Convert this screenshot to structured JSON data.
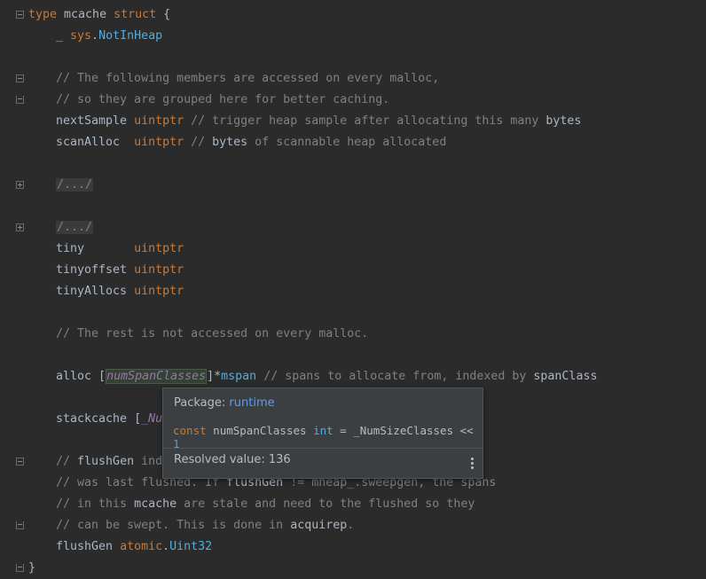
{
  "editor": {
    "lines": {
      "l1_kw": "type",
      "l1_name": " mcache ",
      "l1_kw2": "struct",
      "l1_brace": " {",
      "l2_us": "_ ",
      "l2_pkg": "sys",
      "l2_dot": ".",
      "l2_type": "NotInHeap",
      "l4": "// The following members are accessed on every malloc,",
      "l5": "// so they are grouped here for better caching.",
      "l6_field": "nextSample ",
      "l6_type": "uintptr",
      "l6_cmt_a": " // trigger heap sample after allocating this many ",
      "l6_cmt_b": "bytes",
      "l7_field": "scanAlloc  ",
      "l7_type": "uintptr",
      "l7_cmt_a": " // ",
      "l7_cmt_b": "bytes",
      "l7_cmt_c": " of scannable heap allocated",
      "l9": "/.../",
      "l11": "/.../",
      "l12_field": "tiny       ",
      "l12_type": "uintptr",
      "l13_field": "tinyoffset ",
      "l13_type": "uintptr",
      "l14_field": "tinyAllocs ",
      "l14_type": "uintptr",
      "l16": "// The rest is not accessed on every malloc.",
      "l18_field": "alloc ",
      "l18_lb": "[",
      "l18_param": "numSpanClasses",
      "l18_rb": "]*",
      "l18_type": "mspan",
      "l18_cmt_a": " // spans to allocate from, indexed by ",
      "l18_cmt_b": "spanClass",
      "l20_field": "stackcache ",
      "l20_lb": "[",
      "l20_param": "_Nu",
      "l22_cmt_a": "// ",
      "l22_cmt_b": "flushGen",
      "l22_cmt_c": " ind",
      "l23_cmt_a": "// was last flushed. If ",
      "l23_cmt_b": "flushGen",
      "l23_cmt_c": " != mheap_.sweepgen, the spans",
      "l24_cmt_a": "// in this ",
      "l24_cmt_b": "mcache",
      "l24_cmt_c": " are stale and need to the flushed so they",
      "l25_cmt_a": "// can be swept. This is done in ",
      "l25_cmt_b": "acquirep",
      "l25_cmt_c": ".",
      "l26_field": "flushGen ",
      "l26_pkg": "atomic",
      "l26_dot": ".",
      "l26_type": "Uint32",
      "l27": "}"
    }
  },
  "popup": {
    "package_label": "Package: ",
    "package_name": "runtime",
    "decl_kw": "const",
    "decl_name": " numSpanClasses ",
    "decl_type": "int",
    "decl_rest": " = _NumSizeClasses << ",
    "decl_num": "1",
    "resolved_label": "Resolved value: ",
    "resolved_value": "136"
  },
  "colors": {
    "background": "#2b2b2b",
    "keyword": "#cc7832",
    "comment": "#808080",
    "type": "#4eade5",
    "link": "#589df6"
  }
}
